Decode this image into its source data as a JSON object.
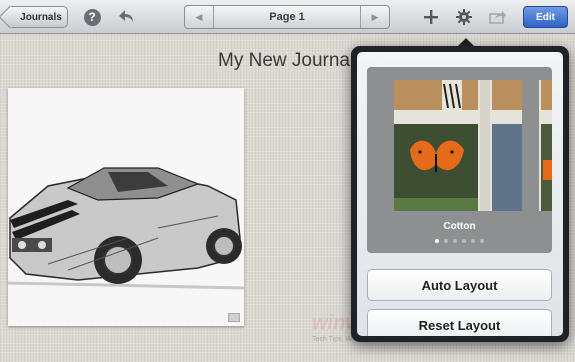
{
  "toolbar": {
    "back_label": "Journals",
    "help_icon": "question-circle-icon",
    "undo_icon": "undo-icon",
    "page_label": "Page 1",
    "prev_icon": "triangle-left-icon",
    "next_icon": "triangle-right-icon",
    "add_icon": "plus-icon",
    "settings_icon": "gear-icon",
    "share_icon": "share-icon",
    "edit_label": "Edit",
    "accent": "#3a6fd2"
  },
  "page": {
    "title": "My New Journal",
    "image": "pencil-sketch-car"
  },
  "watermark": {
    "brand": "winwalls",
    "tagline": "Tech Tips, Windows, Freeware, Social Media and Tutori"
  },
  "popover": {
    "theme": {
      "name": "Cotton",
      "page_count": 6,
      "active_index": 0
    },
    "buttons": {
      "auto_layout": "Auto Layout",
      "reset_layout": "Reset Layout"
    }
  }
}
